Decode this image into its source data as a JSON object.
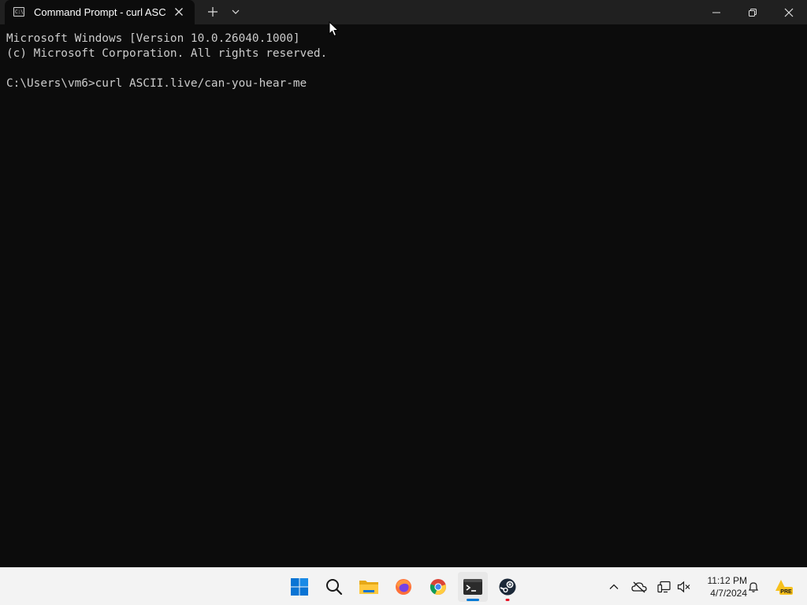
{
  "window": {
    "tab_title": "Command Prompt - curl  ASC",
    "tab_icon_text": "C:\\",
    "icons": {
      "tab": "command-prompt-icon",
      "close_tab": "close-icon",
      "new_tab": "plus-icon",
      "dropdown": "chevron-down-icon",
      "minimize": "minimize-icon",
      "maximize": "restore-icon",
      "close": "close-icon"
    }
  },
  "terminal": {
    "lines": [
      "Microsoft Windows [Version 10.0.26040.1000]",
      "(c) Microsoft Corporation. All rights reserved.",
      "",
      "C:\\Users\\vm6>curl ASCII.live/can-you-hear-me"
    ],
    "colors": {
      "background": "#0c0c0c",
      "text": "#cccccc"
    }
  },
  "taskbar": {
    "apps": [
      {
        "name": "start",
        "icon": "windows-logo-icon"
      },
      {
        "name": "search",
        "icon": "search-icon"
      },
      {
        "name": "file-explorer",
        "icon": "folder-icon"
      },
      {
        "name": "firefox",
        "icon": "firefox-icon"
      },
      {
        "name": "chrome",
        "icon": "chrome-icon"
      },
      {
        "name": "terminal",
        "icon": "terminal-icon",
        "active": true
      },
      {
        "name": "steam",
        "icon": "steam-icon",
        "running": true
      }
    ],
    "tray": {
      "icons": [
        "chevron-up-icon",
        "onedrive-offline-icon",
        "network-icon",
        "volume-muted-icon",
        "notification-bell-icon",
        "pre-badge-icon"
      ],
      "badge_text": "PRE"
    },
    "clock": {
      "time": "11:12 PM",
      "date": "4/7/2024"
    },
    "colors": {
      "background": "#f3f3f3",
      "accent": "#0078d4",
      "running_dot": "#e81123"
    }
  }
}
